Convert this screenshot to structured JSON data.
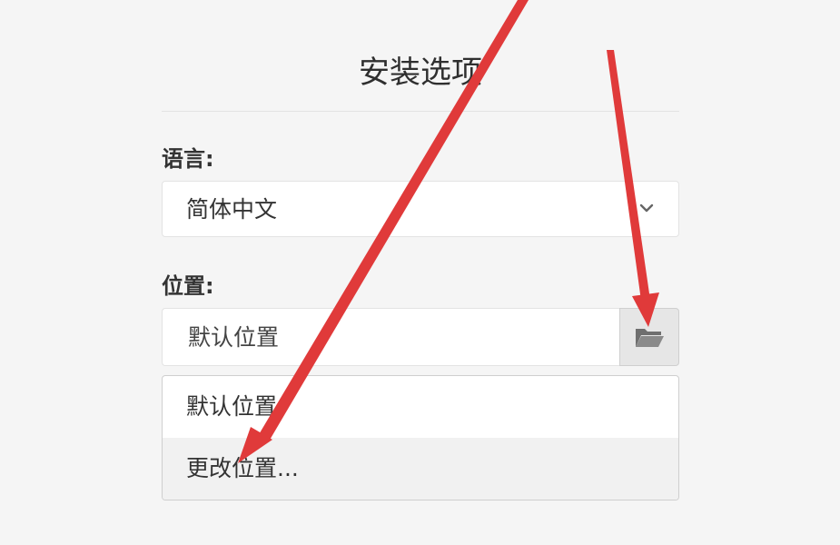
{
  "dialog": {
    "title": "安装选项"
  },
  "language": {
    "label": "语言:",
    "selected": "简体中文",
    "icon": "chevron-down-icon"
  },
  "location": {
    "label": "位置:",
    "value": "默认位置",
    "browse_icon": "folder-open-icon"
  },
  "location_options": [
    {
      "label": "默认位置"
    },
    {
      "label": "更改位置..."
    }
  ],
  "colors": {
    "annotation_arrow": "#e03a3a",
    "background": "#f5f5f5",
    "folder_button": "#e6e6e6"
  }
}
